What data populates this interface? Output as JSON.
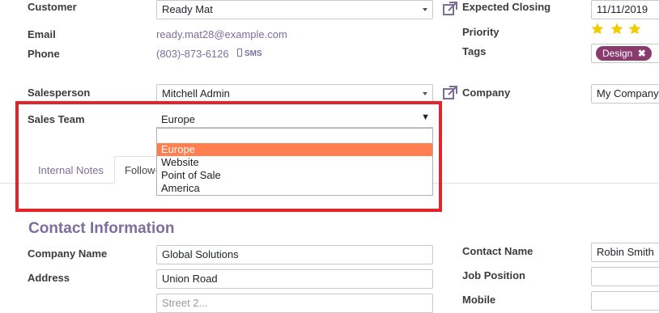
{
  "left": {
    "customer_label": "Customer",
    "customer_value": "Ready Mat",
    "email_label": "Email",
    "email_value": "ready.mat28@example.com",
    "phone_label": "Phone",
    "phone_value": "(803)-873-6126",
    "sms_label": "SMS",
    "salesperson_label": "Salesperson",
    "salesperson_value": "Mitchell Admin",
    "sales_team_label": "Sales Team",
    "sales_team_value": "Europe"
  },
  "right": {
    "expected_closing_label": "Expected Closing",
    "expected_closing_value": "11/11/2019",
    "priority_label": "Priority",
    "priority_stars": 3,
    "tags_label": "Tags",
    "tag_value": "Design",
    "company_label": "Company",
    "company_value": "My Company"
  },
  "dropdown": {
    "search_value": "",
    "options": [
      "Europe",
      "Website",
      "Point of Sale",
      "America"
    ],
    "selected": "Europe"
  },
  "tabs": {
    "internal_notes": "Internal Notes",
    "followup": "Follow-"
  },
  "contact": {
    "title": "Contact Information",
    "company_name_label": "Company Name",
    "company_name_value": "Global Solutions",
    "address_label": "Address",
    "address_value": "Union Road",
    "street2_placeholder": "Street 2...",
    "contact_name_label": "Contact Name",
    "contact_name_value": "Robin Smith",
    "job_position_label": "Job Position",
    "job_position_value": "",
    "mobile_label": "Mobile",
    "mobile_value": ""
  },
  "colors": {
    "accent": "#7c6e9c",
    "highlight": "#ff7f50",
    "tag": "#8a3b6e",
    "star": "#f3cc00",
    "annotation": "#e3242b"
  }
}
